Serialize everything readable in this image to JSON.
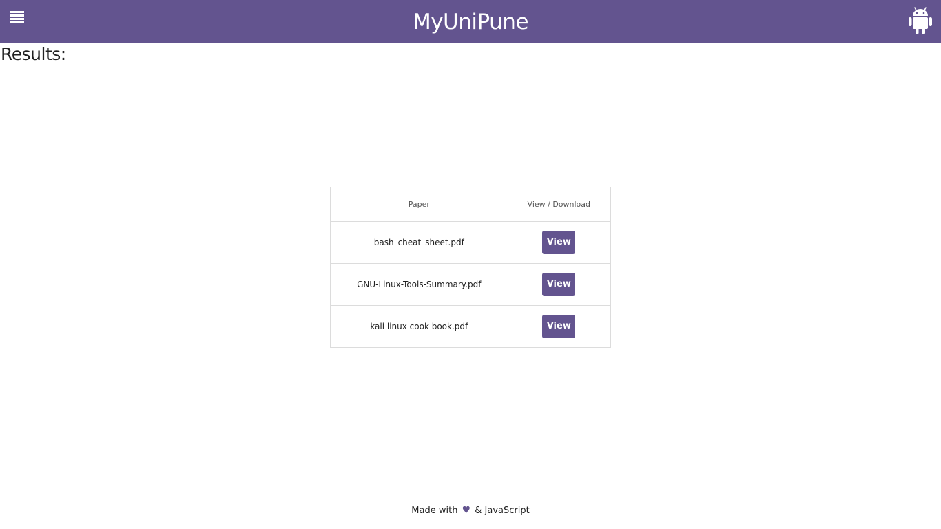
{
  "header": {
    "title": "MyUniPune",
    "menu_icon": "hamburger-menu-icon",
    "app_icon": "android-icon",
    "background_color": "#63548f"
  },
  "main": {
    "heading": "Results:",
    "table": {
      "columns": [
        "Paper",
        "View / Download"
      ],
      "rows": [
        {
          "paper": "bash_cheat_sheet.pdf",
          "action": "View"
        },
        {
          "paper": "GNU-Linux-Tools-Summary.pdf",
          "action": "View"
        },
        {
          "paper": "kali linux cook book.pdf",
          "action": "View"
        }
      ]
    }
  },
  "footer": {
    "prefix": "Made with",
    "heart": "♥",
    "suffix": "& JavaScript"
  },
  "colors": {
    "accent": "#63548f",
    "text": "#222222",
    "border": "#dcdcdc"
  }
}
